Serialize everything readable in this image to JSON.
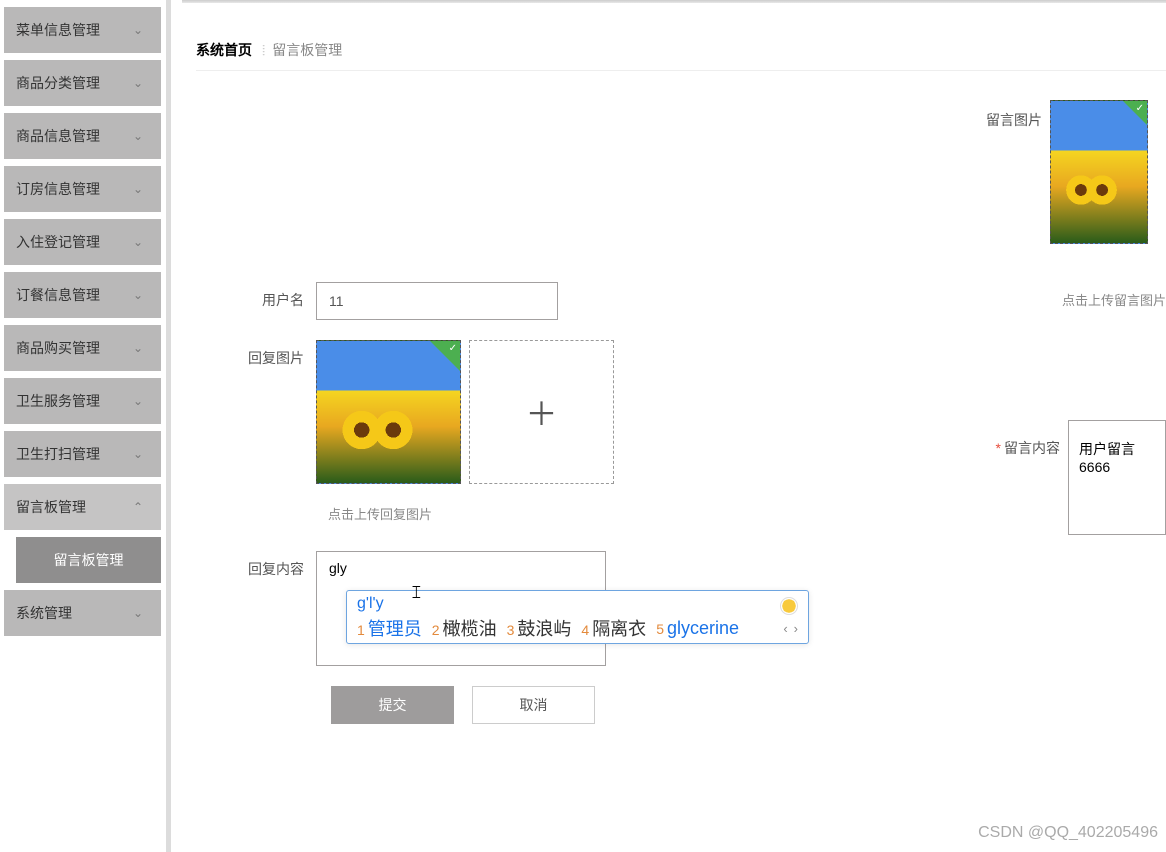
{
  "sidebar": {
    "items": [
      {
        "label": "菜单信息管理",
        "expanded": false
      },
      {
        "label": "商品分类管理",
        "expanded": false
      },
      {
        "label": "商品信息管理",
        "expanded": false
      },
      {
        "label": "订房信息管理",
        "expanded": false
      },
      {
        "label": "入住登记管理",
        "expanded": false
      },
      {
        "label": "订餐信息管理",
        "expanded": false
      },
      {
        "label": "商品购买管理",
        "expanded": false
      },
      {
        "label": "卫生服务管理",
        "expanded": false
      },
      {
        "label": "卫生打扫管理",
        "expanded": false
      },
      {
        "label": "留言板管理",
        "expanded": true,
        "children": [
          {
            "label": "留言板管理"
          }
        ]
      },
      {
        "label": "系统管理",
        "expanded": false
      }
    ]
  },
  "breadcrumb": {
    "home": "系统首页",
    "current": "留言板管理"
  },
  "form": {
    "username_label": "用户名",
    "username_value": "11",
    "reply_image_label": "回复图片",
    "reply_image_hint": "点击上传回复图片",
    "reply_content_label": "回复内容",
    "reply_content_value": "gly",
    "submit_label": "提交",
    "cancel_label": "取消"
  },
  "right": {
    "image_label": "留言图片",
    "image_hint": "点击上传留言图片",
    "content_label": "留言内容",
    "content_value": "用户留言6666"
  },
  "ime": {
    "input": "g'l'y",
    "candidates": [
      {
        "idx": "1",
        "word": "管理员"
      },
      {
        "idx": "2",
        "word": "橄榄油"
      },
      {
        "idx": "3",
        "word": "鼓浪屿"
      },
      {
        "idx": "4",
        "word": "隔离衣"
      },
      {
        "idx": "5",
        "word": "glycerine"
      }
    ],
    "prev": "‹",
    "next": "›"
  },
  "watermark": "CSDN @QQ_402205496"
}
